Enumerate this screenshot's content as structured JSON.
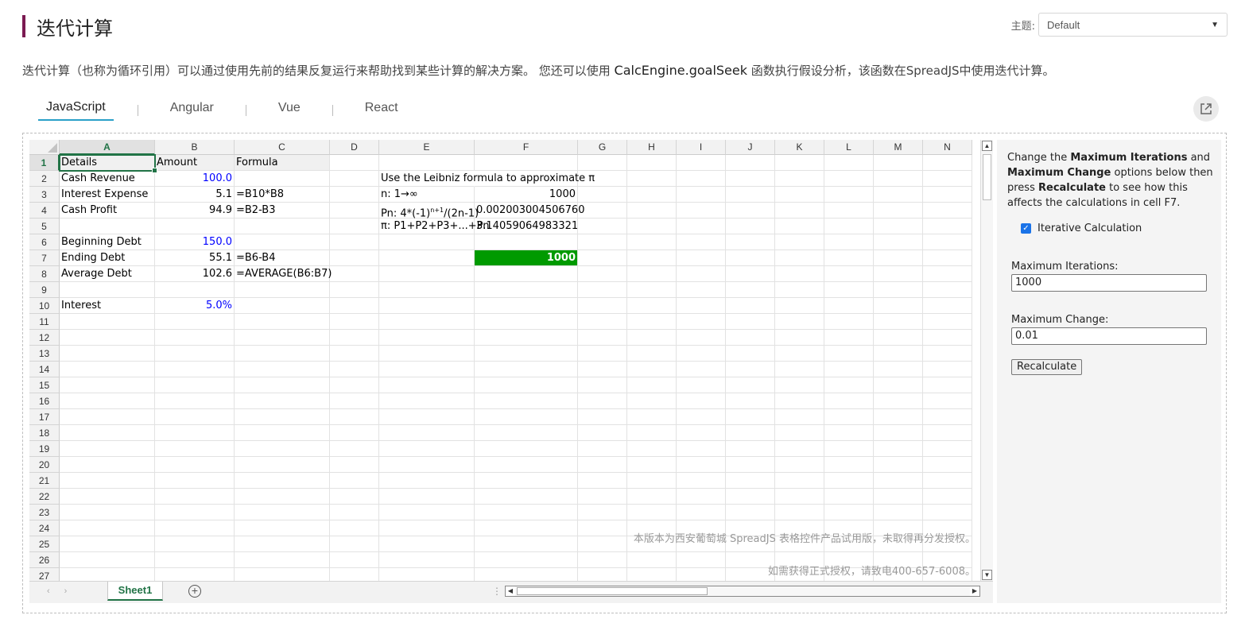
{
  "page": {
    "title": "迭代计算",
    "theme_label": "主题:",
    "theme_value": "Default",
    "description_pre": "迭代计算（也称为循环引用）可以通过使用先前的结果反复运行来帮助找到某些计算的解决方案。 您还可以使用 ",
    "description_code": "CalcEngine.goalSeek",
    "description_post": " 函数执行假设分析，该函数在SpreadJS中使用迭代计算。",
    "tabs": [
      "JavaScript",
      "Angular",
      "Vue",
      "React"
    ],
    "active_tab": "JavaScript"
  },
  "sheet": {
    "columns": [
      "A",
      "B",
      "C",
      "D",
      "E",
      "F",
      "G",
      "H",
      "I",
      "J",
      "K",
      "L",
      "M",
      "N"
    ],
    "rows": [
      "1",
      "2",
      "3",
      "4",
      "5",
      "6",
      "7",
      "8",
      "9",
      "10",
      "11",
      "12",
      "13",
      "14",
      "15",
      "16",
      "17",
      "18",
      "19",
      "20",
      "21",
      "22",
      "23",
      "24",
      "25",
      "26",
      "27"
    ],
    "cells": {
      "A1": "Details",
      "B1": "Amount",
      "C1": "Formula",
      "A2": "Cash Revenue",
      "B2": "100.0",
      "A3": "Interest Expense",
      "B3": "5.1",
      "C3": "=B10*B8",
      "A4": "Cash Profit",
      "B4": "94.9",
      "C4": "=B2-B3",
      "A6": "Beginning Debt",
      "B6": "150.0",
      "A7": "Ending Debt",
      "B7": "55.1",
      "C7": "=B6-B4",
      "A8": "Average Debt",
      "B8": "102.6",
      "C8": "=AVERAGE(B6:B7)",
      "A10": "Interest",
      "B10": "5.0%",
      "E2": "Use the Leibniz formula to approximate π",
      "E3": "n: 1→∞",
      "F3": "1000",
      "E4_base": "Pn: 4*(-1)",
      "E4_sup": "n+1",
      "E4_tail": "/(2n-1)",
      "F4": "0.002003004506760",
      "E5": "π: P1+P2+P3+...+Pn",
      "F5": "3.14059064983321",
      "F7": "1000"
    },
    "watermark_line1": "本版本为西安葡萄城 SpreadJS 表格控件产品试用版，未取得再分发授权。",
    "watermark_line2": "如需获得正式授权，请致电400-657-6008。",
    "sheet_tab": "Sheet1",
    "add_sheet_symbol": "+",
    "tab_dots": "⋮",
    "highlight_color": "#009a00",
    "value_color": "#0000ff"
  },
  "panel": {
    "iterative_label": "Iterative Calculation",
    "iterative_checked": true,
    "max_iterations_label": "Maximum Iterations:",
    "max_iterations_value": "1000",
    "max_change_label": "Maximum Change:",
    "max_change_value": "0.01",
    "recalc_button": "Recalculate"
  }
}
